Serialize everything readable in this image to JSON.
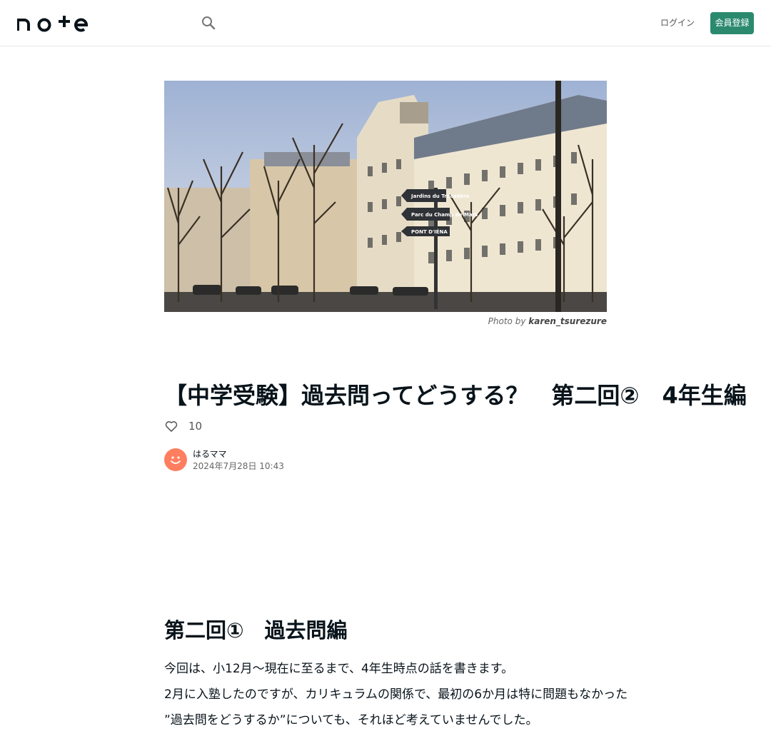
{
  "header": {
    "logo_text": "note",
    "login_label": "ログイン",
    "signup_label": "会員登録",
    "icons": {
      "search": "search-icon"
    }
  },
  "hero": {
    "credit_prefix": "Photo by",
    "credit_author": "karen_tsurezure",
    "sign_texts": [
      "Jardins du Trocadéro",
      "Parc du Champ de Mars",
      "PONT D'IÉNA"
    ]
  },
  "article": {
    "title": "【中学受験】過去問ってどうする？　第二回②　4年生編",
    "like_count": "10",
    "author_name": "はるママ",
    "date": "2024年7月28日 10:43",
    "section_heading": "第二回①　過去問編",
    "paragraphs": [
      "今回は、小12月〜現在に至るまで、4年生時点の話を書きます。",
      "2月に入塾したのですが、カリキュラムの関係で、最初の6か月は特に問題もなかった",
      "”過去問をどうするか”についても、それほど考えていませんでした。"
    ]
  },
  "colors": {
    "brand_green": "#2b8a6e",
    "avatar": "#ff7e5f",
    "text": "#08131a"
  }
}
